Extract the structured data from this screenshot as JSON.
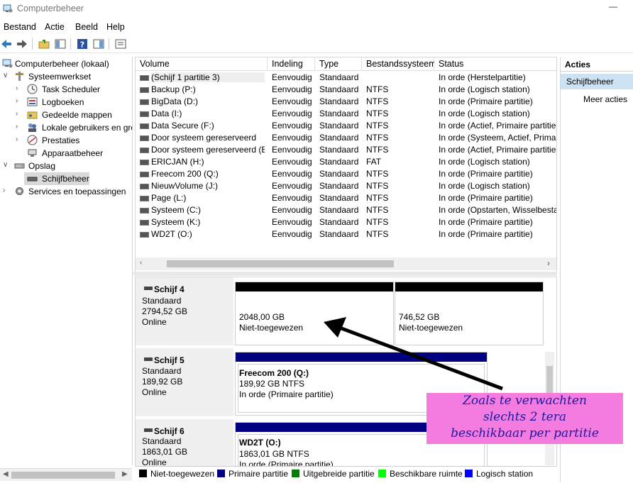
{
  "window": {
    "title": "Computerbeheer"
  },
  "menu": [
    "Bestand",
    "Actie",
    "Beeld",
    "Help"
  ],
  "tree": {
    "items": [
      {
        "label": "Computerbeheer (lokaal)",
        "icon": "computer-management-icon"
      },
      {
        "label": "Systeemwerkset",
        "icon": "tools-icon"
      },
      {
        "label": "Task Scheduler",
        "icon": "clock-icon"
      },
      {
        "label": "Logboeken",
        "icon": "event-viewer-icon"
      },
      {
        "label": "Gedeelde mappen",
        "icon": "shared-folder-icon"
      },
      {
        "label": "Lokale gebruikers en gro",
        "icon": "users-icon"
      },
      {
        "label": "Prestaties",
        "icon": "performance-icon"
      },
      {
        "label": "Apparaatbeheer",
        "icon": "device-manager-icon"
      },
      {
        "label": "Opslag",
        "icon": "storage-icon"
      },
      {
        "label": "Schijfbeheer",
        "icon": "disk-icon"
      },
      {
        "label": "Services en toepassingen",
        "icon": "services-icon"
      }
    ]
  },
  "columns": [
    "Volume",
    "Indeling",
    "Type",
    "Bestandssysteem",
    "Status"
  ],
  "volumes": [
    {
      "volume": "(Schijf 1 partitie 3)",
      "indeling": "Eenvoudig",
      "type": "Standaard",
      "fs": "",
      "status": "In orde (Herstelpartitie)"
    },
    {
      "volume": "Backup (P:)",
      "indeling": "Eenvoudig",
      "type": "Standaard",
      "fs": "NTFS",
      "status": "In orde (Logisch station)"
    },
    {
      "volume": "BigData (D:)",
      "indeling": "Eenvoudig",
      "type": "Standaard",
      "fs": "NTFS",
      "status": "In orde (Primaire partitie)"
    },
    {
      "volume": "Data (I:)",
      "indeling": "Eenvoudig",
      "type": "Standaard",
      "fs": "NTFS",
      "status": "In orde (Logisch station)"
    },
    {
      "volume": "Data Secure (F:)",
      "indeling": "Eenvoudig",
      "type": "Standaard",
      "fs": "NTFS",
      "status": "In orde (Actief, Primaire partitie)"
    },
    {
      "volume": "Door systeem gereserveerd",
      "indeling": "Eenvoudig",
      "type": "Standaard",
      "fs": "NTFS",
      "status": "In orde (Systeem, Actief, Primair"
    },
    {
      "volume": "Door systeem gereserveerd (E:)",
      "indeling": "Eenvoudig",
      "type": "Standaard",
      "fs": "NTFS",
      "status": "In orde (Actief, Primaire partitie)"
    },
    {
      "volume": "ERICJAN (H:)",
      "indeling": "Eenvoudig",
      "type": "Standaard",
      "fs": "FAT",
      "status": "In orde (Logisch station)"
    },
    {
      "volume": "Freecom 200 (Q:)",
      "indeling": "Eenvoudig",
      "type": "Standaard",
      "fs": "NTFS",
      "status": "In orde (Primaire partitie)"
    },
    {
      "volume": "NieuwVolume (J:)",
      "indeling": "Eenvoudig",
      "type": "Standaard",
      "fs": "NTFS",
      "status": "In orde (Logisch station)"
    },
    {
      "volume": "Page (L:)",
      "indeling": "Eenvoudig",
      "type": "Standaard",
      "fs": "NTFS",
      "status": "In orde (Primaire partitie)"
    },
    {
      "volume": "Systeem (C:)",
      "indeling": "Eenvoudig",
      "type": "Standaard",
      "fs": "NTFS",
      "status": "In orde (Opstarten, Wisselbestar"
    },
    {
      "volume": "Systeem (K:)",
      "indeling": "Eenvoudig",
      "type": "Standaard",
      "fs": "NTFS",
      "status": "In orde (Primaire partitie)"
    },
    {
      "volume": "WD2T (O:)",
      "indeling": "Eenvoudig",
      "type": "Standaard",
      "fs": "NTFS",
      "status": "In orde (Primaire partitie)"
    }
  ],
  "disks": [
    {
      "name": "Schijf 4",
      "type": "Standaard",
      "size": "2794,52 GB",
      "state": "Online",
      "partitions": [
        {
          "bar": "#000000",
          "l1": "2048,00 GB",
          "l2": "Niet-toegewezen",
          "l3": ""
        },
        {
          "bar": "#000000",
          "l1": "746,52 GB",
          "l2": "Niet-toegewezen",
          "l3": ""
        }
      ]
    },
    {
      "name": "Schijf 5",
      "type": "Standaard",
      "size": "189,92 GB",
      "state": "Online",
      "partitions": [
        {
          "bar": "#000080",
          "l1": "Freecom 200  (Q:)",
          "l2": "189,92 GB NTFS",
          "l3": "In orde (Primaire partitie)"
        }
      ]
    },
    {
      "name": "Schijf 6",
      "type": "Standaard",
      "size": "1863,01 GB",
      "state": "Online",
      "partitions": [
        {
          "bar": "#000080",
          "l1": "WD2T  (O:)",
          "l2": "1863,01 GB NTFS",
          "l3": "In orde (Primaire partitie)"
        }
      ]
    }
  ],
  "legend": [
    {
      "label": "Niet-toegewezen",
      "color": "#000000"
    },
    {
      "label": "Primaire partitie",
      "color": "#000080"
    },
    {
      "label": "Uitgebreide partitie",
      "color": "#008000"
    },
    {
      "label": "Beschikbare ruimte",
      "color": "#00ff00"
    },
    {
      "label": "Logisch station",
      "color": "#0000ff"
    }
  ],
  "actions": {
    "header": "Acties",
    "section": "Schijfbeheer",
    "more": "Meer acties"
  },
  "annotation": {
    "lines": [
      "Zoals te verwachten",
      "slechts 2 tera",
      "beschikbaar per partitie"
    ],
    "color": "#f47ce0"
  }
}
